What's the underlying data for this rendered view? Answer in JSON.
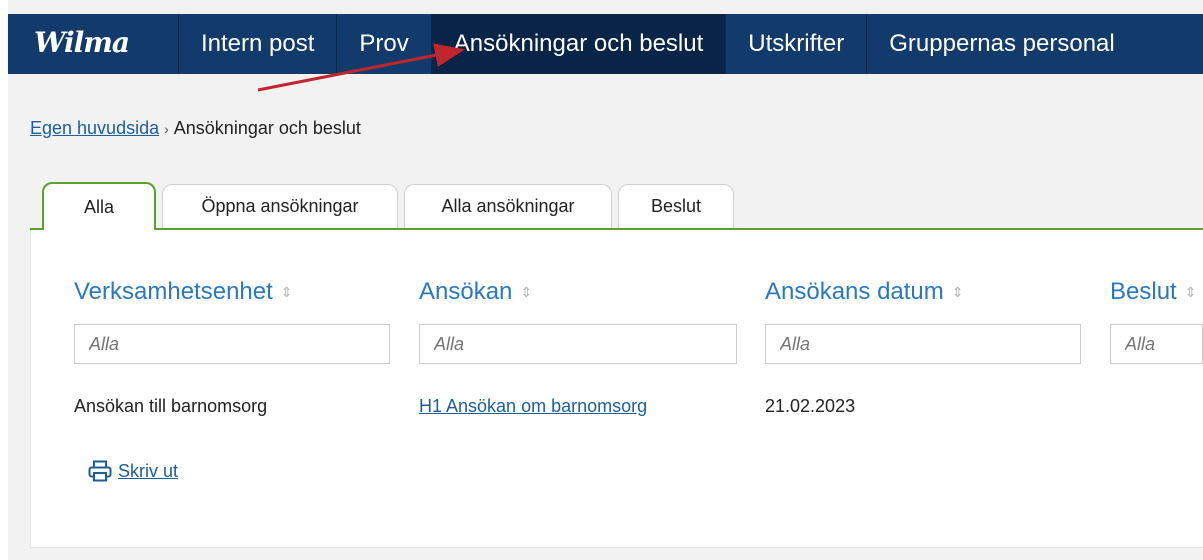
{
  "app": {
    "logo": "Wilma"
  },
  "nav": {
    "items": [
      {
        "label": "Intern post"
      },
      {
        "label": "Prov"
      },
      {
        "label": "Ansökningar och beslut"
      },
      {
        "label": "Utskrifter"
      },
      {
        "label": "Gruppernas personal"
      }
    ],
    "active_index": 2
  },
  "breadcrumb": {
    "home": "Egen huvudsida",
    "separator": "›",
    "current": "Ansökningar och beslut"
  },
  "tabs": [
    {
      "label": "Alla"
    },
    {
      "label": "Öppna ansökningar"
    },
    {
      "label": "Alla ansökningar"
    },
    {
      "label": "Beslut"
    }
  ],
  "table": {
    "columns": [
      {
        "label": "Verksamhetsenhet",
        "sort_icon": "⇕"
      },
      {
        "label": "Ansökan",
        "sort_icon": "⇕"
      },
      {
        "label": "Ansökans datum",
        "sort_icon": "⇕"
      },
      {
        "label": "Beslut",
        "sort_icon": "⇕"
      }
    ],
    "filter_placeholder": "Alla",
    "rows": [
      {
        "unit": "Ansökan till barnomsorg",
        "application": "H1 Ansökan om barnomsorg",
        "date": "21.02.2023",
        "decision": ""
      }
    ]
  },
  "print": {
    "label": "Skriv ut",
    "icon": "printer-icon"
  },
  "colors": {
    "nav_bg": "#123a6b",
    "nav_active": "#082447",
    "accent_green": "#5aa02c",
    "link": "#1c5e9a",
    "heading": "#2a78c0",
    "arrow": "#c0262c"
  }
}
